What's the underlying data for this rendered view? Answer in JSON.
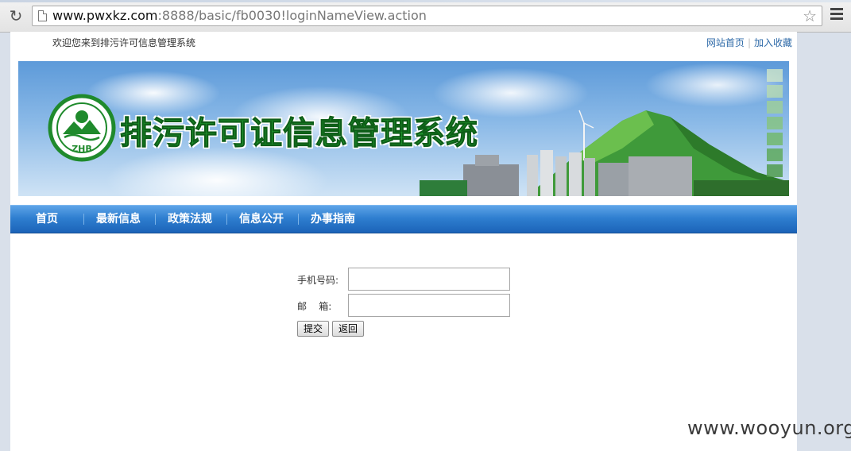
{
  "browser": {
    "url_host": "www.pwxkz.com",
    "url_rest": ":8888/basic/fb0030!loginNameView.action"
  },
  "topbar": {
    "welcome": "欢迎您来到排污许可信息管理系统",
    "links": [
      "网站首页",
      "加入收藏"
    ]
  },
  "banner": {
    "title": "排污许可证信息管理系统",
    "logo_text": "ZHB",
    "title_color": "#1f9a2e"
  },
  "nav": {
    "items": [
      "首页",
      "最新信息",
      "政策法规",
      "信息公开",
      "办事指南"
    ]
  },
  "form": {
    "phone_label": "手机号码:",
    "phone_value": "",
    "email_label": "邮    箱:",
    "email_value": "",
    "submit_label": "提交",
    "back_label": "返回"
  },
  "watermark": "www.wooyun.org",
  "colors": {
    "nav_blue": "#2f7fd0",
    "link_blue": "#2e6aa8"
  }
}
